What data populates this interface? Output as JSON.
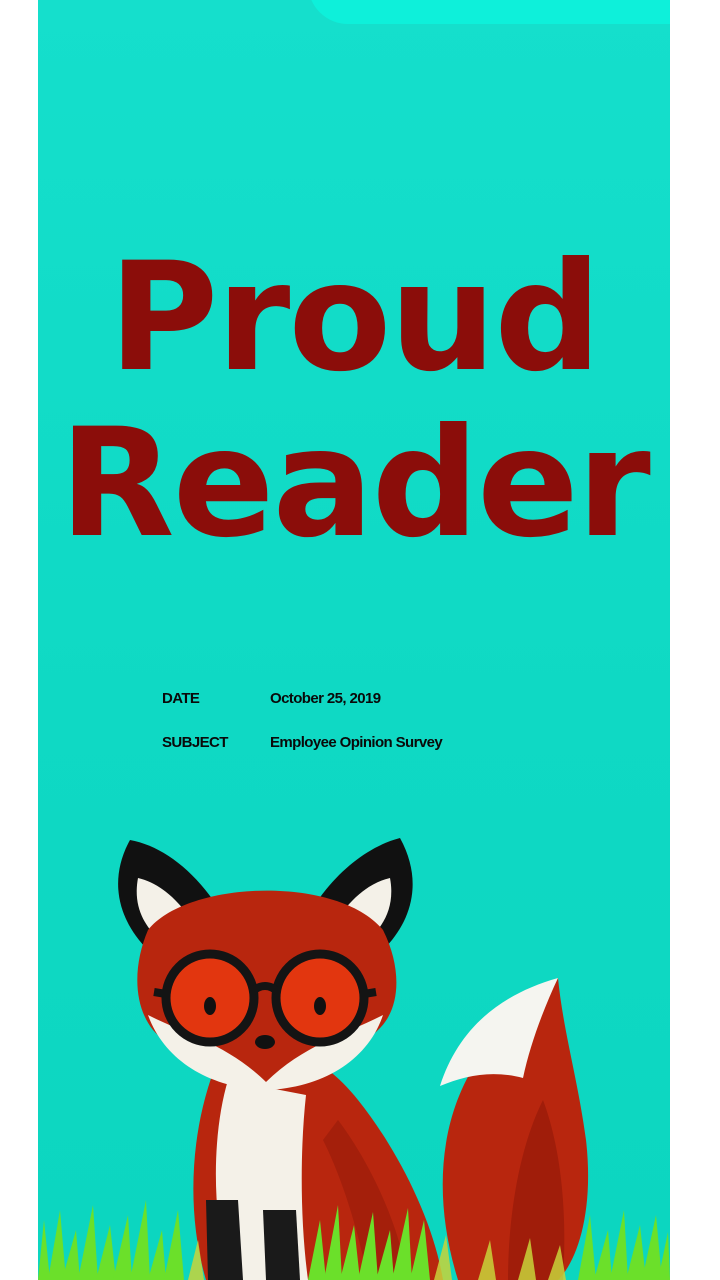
{
  "cover": {
    "title_line1": "Proud",
    "title_line2": "Reader",
    "colors": {
      "background": "#10dcc7",
      "title": "#8b0d0a",
      "fox": "#b8260e"
    }
  },
  "memo": {
    "date_label": "DATE",
    "date_value": "October 25, 2019",
    "subject_label": "SUBJECT",
    "subject_value": "Employee Opinion Survey"
  },
  "illustration": {
    "icon": "fox-with-glasses-icon"
  }
}
